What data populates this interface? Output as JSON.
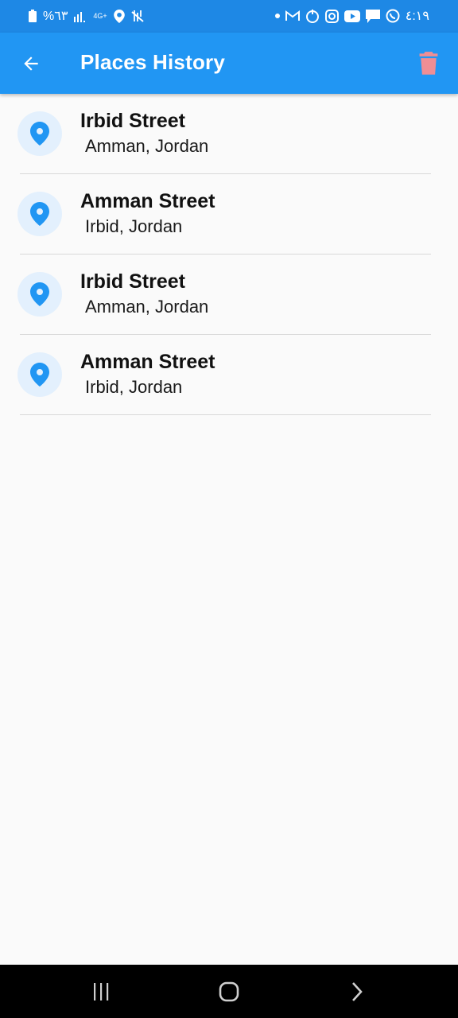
{
  "status_bar": {
    "battery_text": "%٦٣",
    "network_text": "4G+",
    "time": "٤:١٩"
  },
  "app_bar": {
    "title": "Places History",
    "back_icon": "arrow-left-icon",
    "delete_icon": "trash-icon"
  },
  "colors": {
    "status_bar": "#1e88e5",
    "app_bar": "#2196f3",
    "pin": "#2196f3",
    "avatar_bg": "#e3f0fd",
    "delete_icon": "#ef8e95"
  },
  "places": [
    {
      "title": "Irbid Street",
      "subtitle": "Amman, Jordan"
    },
    {
      "title": "Amman Street",
      "subtitle": "Irbid, Jordan"
    },
    {
      "title": "Irbid Street",
      "subtitle": "Amman, Jordan"
    },
    {
      "title": "Amman Street",
      "subtitle": "Irbid, Jordan"
    }
  ],
  "nav_bar": {
    "recents_icon": "recents-icon",
    "home_icon": "home-icon",
    "back_icon": "chevron-right-icon"
  }
}
